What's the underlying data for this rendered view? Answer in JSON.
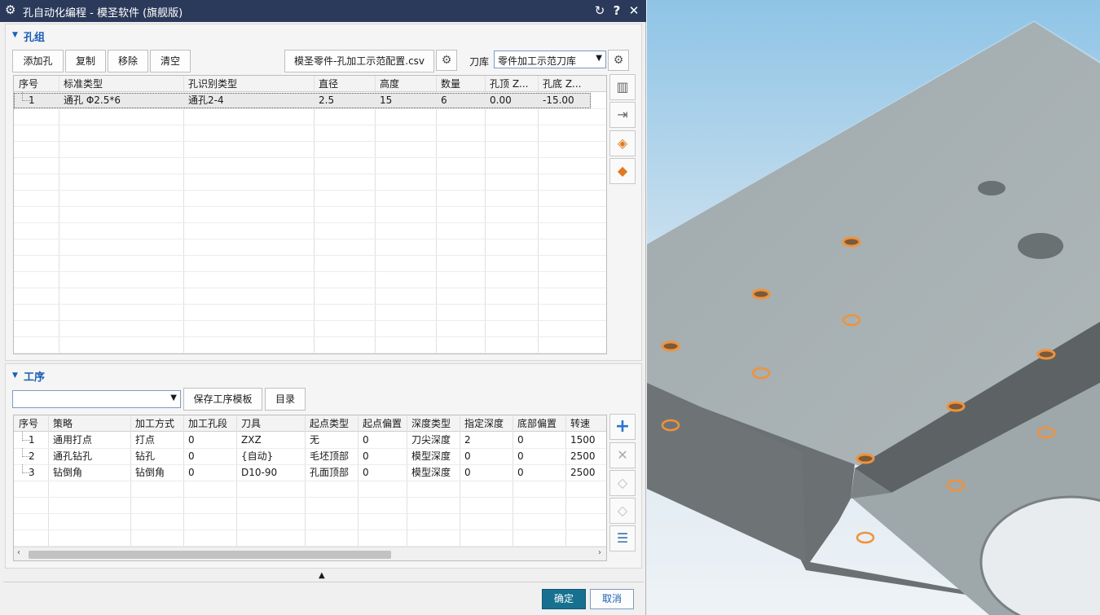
{
  "window": {
    "title": "孔自动化编程 - 模圣软件 (旗舰版)"
  },
  "hole_group": {
    "section_title": "孔组",
    "buttons": {
      "add": "添加孔",
      "copy": "复制",
      "remove": "移除",
      "clear": "清空"
    },
    "config_file": "模圣零件-孔加工示范配置.csv",
    "tool_lib_label": "刀库",
    "tool_lib_value": "零件加工示范刀库",
    "columns": [
      "序号",
      "标准类型",
      "孔识别类型",
      "直径",
      "高度",
      "数量",
      "孔顶 Z...",
      "孔底 Z..."
    ],
    "rows": [
      [
        "1",
        "通孔 Φ2.5*6",
        "通孔2-4",
        "2.5",
        "15",
        "6",
        "0.00",
        "-15.00"
      ]
    ]
  },
  "process": {
    "section_title": "工序",
    "template_select": "",
    "buttons": {
      "save_template": "保存工序模板",
      "catalog": "目录"
    },
    "columns": [
      "序号",
      "策略",
      "加工方式",
      "加工孔段",
      "刀具",
      "起点类型",
      "起点偏置",
      "深度类型",
      "指定深度",
      "底部偏置",
      "转速"
    ],
    "rows": [
      [
        "1",
        "通用打点",
        "打点",
        "0",
        "ZXZ",
        "无",
        "0",
        "刀尖深度",
        "2",
        "0",
        "1500"
      ],
      [
        "2",
        "通孔钻孔",
        "钻孔",
        "0",
        "{自动}",
        "毛坯顶部",
        "0",
        "模型深度",
        "0",
        "0",
        "2500"
      ],
      [
        "3",
        "钻倒角",
        "钻倒角",
        "0",
        "D10-90",
        "孔面顶部",
        "0",
        "模型深度",
        "0",
        "0",
        "2500"
      ]
    ]
  },
  "footer": {
    "ok": "确定",
    "cancel": "取消"
  },
  "colors": {
    "title_bar": "#2b3a5a",
    "accent": "#1a5fb4",
    "ok_button": "#17708f",
    "hole_highlight": "#f0923a",
    "part_gray": "#a5aeb0",
    "sky": "#8fc4e6"
  }
}
